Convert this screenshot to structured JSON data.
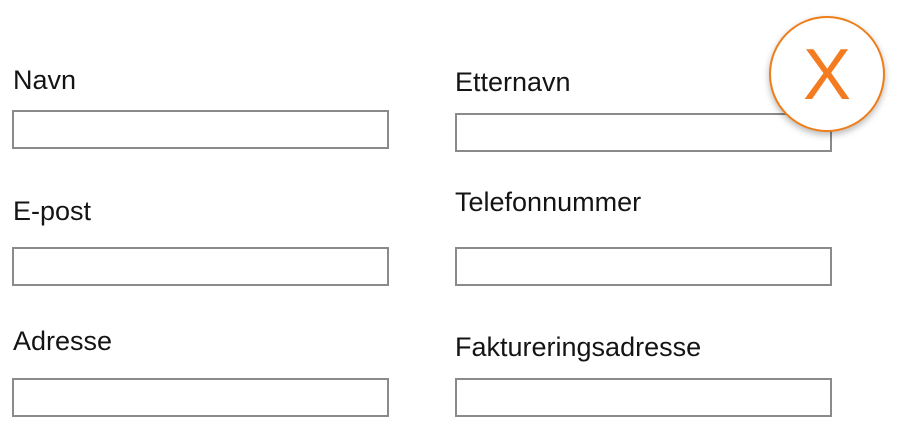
{
  "form": {
    "left": [
      {
        "label": "Navn",
        "value": "",
        "placeholder": ""
      },
      {
        "label": "E-post",
        "value": "",
        "placeholder": ""
      },
      {
        "label": "Adresse",
        "value": "",
        "placeholder": ""
      }
    ],
    "right": [
      {
        "label": "Etternavn",
        "value": "",
        "placeholder": ""
      },
      {
        "label": "Telefonnummer",
        "value": "",
        "placeholder": ""
      },
      {
        "label": "Faktureringsadresse",
        "value": "",
        "placeholder": ""
      }
    ]
  },
  "badge": {
    "glyph": "X",
    "icon": "close-icon",
    "accent_color": "#f47b20"
  }
}
